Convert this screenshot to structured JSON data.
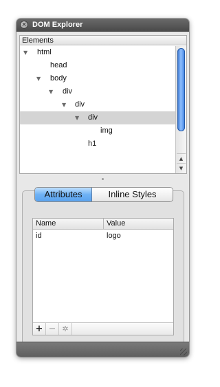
{
  "window": {
    "title": "DOM Explorer"
  },
  "elements_panel": {
    "header": "Elements",
    "tree": [
      {
        "label": "html",
        "expandable": true
      },
      {
        "label": "head",
        "expandable": false
      },
      {
        "label": "body",
        "expandable": true
      },
      {
        "label": "div",
        "expandable": true
      },
      {
        "label": "div",
        "expandable": true
      },
      {
        "label": "div",
        "expandable": true,
        "selected": true
      },
      {
        "label": "img",
        "expandable": false
      },
      {
        "label": "h1",
        "expandable": false
      }
    ]
  },
  "tabs": {
    "attributes": "Attributes",
    "inline_styles": "Inline Styles",
    "selected": "Attributes"
  },
  "attributes_table": {
    "columns": [
      "Name",
      "Value"
    ],
    "rows": [
      {
        "name": "id",
        "value": "logo"
      }
    ]
  },
  "toolbar": {
    "add_icon": "plus-icon",
    "remove_icon": "minus-icon",
    "settings_icon": "gear-icon"
  },
  "colors": {
    "accent": "#5aa3ee",
    "selection": "#d4d4d4"
  }
}
